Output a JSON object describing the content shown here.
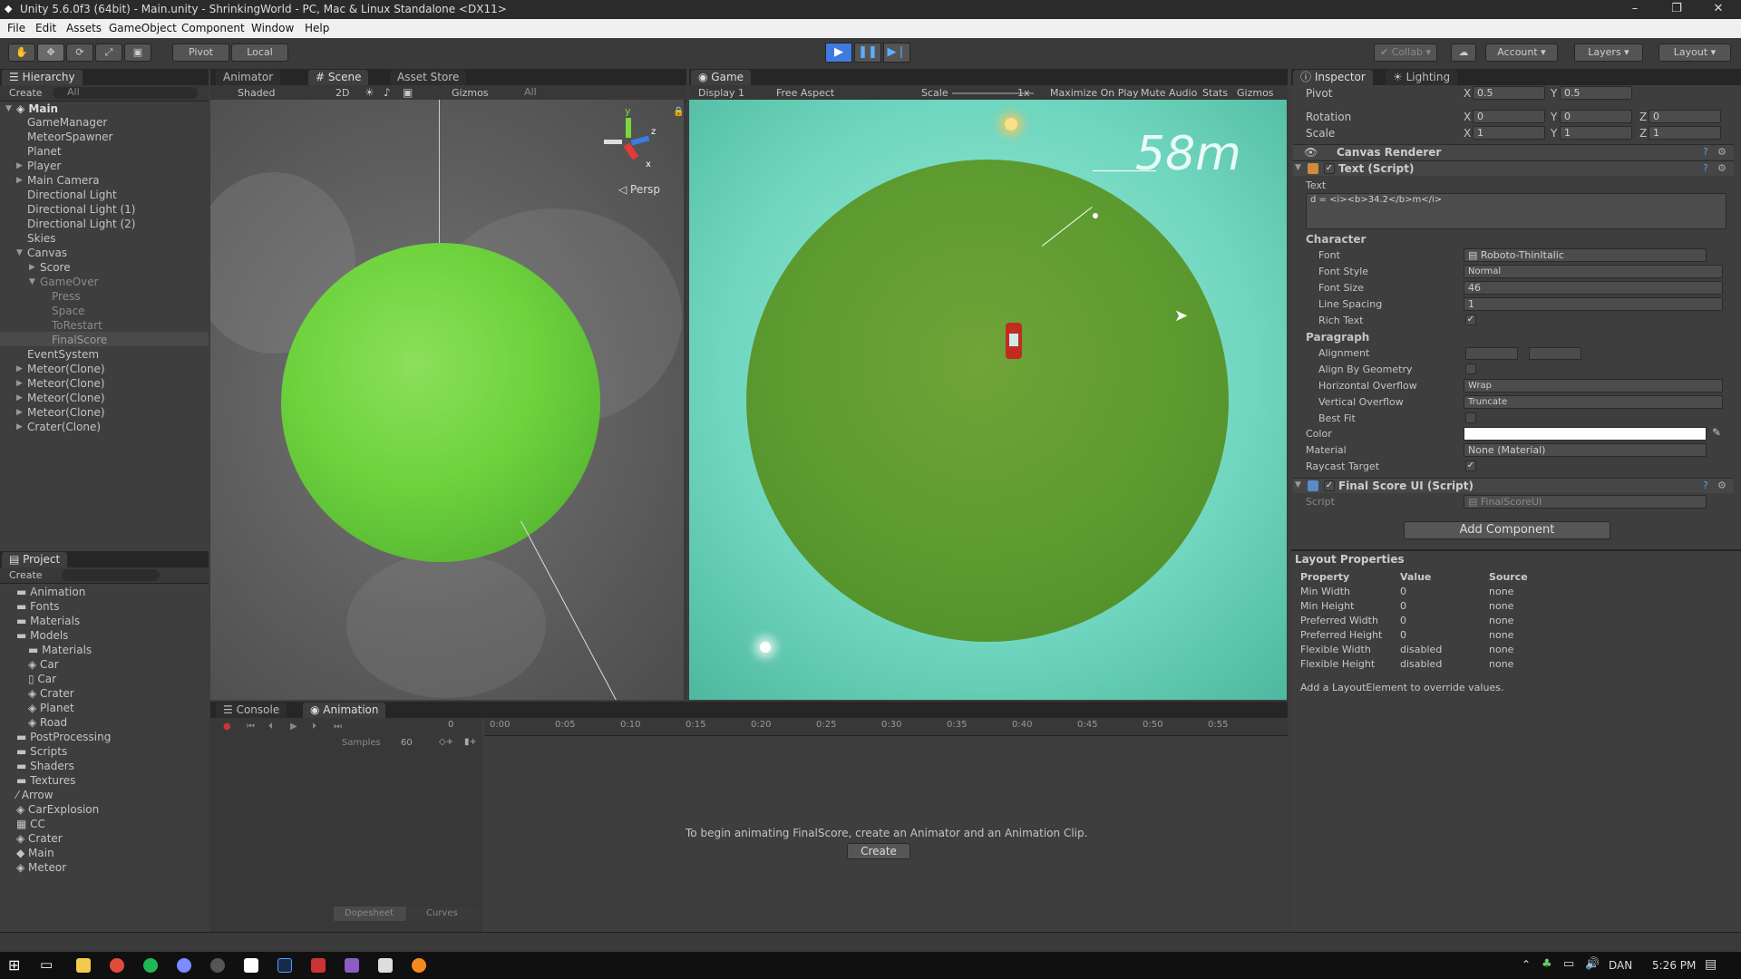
{
  "window": {
    "title": "Unity 5.6.0f3 (64bit) - Main.unity - ShrinkingWorld - PC, Mac & Linux Standalone <DX11>",
    "minimize": "–",
    "maximize": "❐",
    "close": "✕"
  },
  "menu": [
    "File",
    "Edit",
    "Assets",
    "GameObject",
    "Component",
    "Window",
    "Help"
  ],
  "toolbar": {
    "pivot": "Pivot",
    "local": "Local",
    "collab": "Collab",
    "account": "Account",
    "layers": "Layers",
    "layout": "Layout"
  },
  "hierarchy": {
    "tab": "Hierarchy",
    "create": "Create",
    "search": "All",
    "scene": "Main",
    "items": [
      "GameManager",
      "MeteorSpawner",
      "Planet",
      "Player",
      "Main Camera",
      "Directional Light",
      "Directional Light (1)",
      "Directional Light (2)",
      "Skies",
      "Canvas",
      "Score",
      "GameOver",
      "Press",
      "Space",
      "ToRestart",
      "FinalScore",
      "EventSystem",
      "Meteor(Clone)",
      "Meteor(Clone)",
      "Meteor(Clone)",
      "Meteor(Clone)",
      "Crater(Clone)"
    ]
  },
  "project": {
    "tab": "Project",
    "create": "Create",
    "items": [
      "Animation",
      "Fonts",
      "Materials",
      "Models",
      "Materials",
      "Car",
      "Car",
      "Crater",
      "Planet",
      "Road",
      "PostProcessing",
      "Scripts",
      "Shaders",
      "Textures",
      "Arrow",
      "CarExplosion",
      "CC",
      "Crater",
      "Main",
      "Meteor"
    ]
  },
  "scene": {
    "tabs": [
      "Animator",
      "Scene",
      "Asset Store"
    ],
    "shading": "Shaded",
    "mode2d": "2D",
    "gizmos": "Gizmos",
    "search": "All",
    "persp": "Persp",
    "axis_y": "y",
    "axis_z": "z",
    "axis_x": "x"
  },
  "game": {
    "tab": "Game",
    "display": "Display 1",
    "aspect": "Free Aspect",
    "scale_label": "Scale",
    "scale_value": "1x",
    "maximize": "Maximize On Play",
    "mute": "Mute Audio",
    "stats": "Stats",
    "gizmos": "Gizmos",
    "distance": "58m"
  },
  "animation": {
    "tabs": [
      "Console",
      "Animation"
    ],
    "samples_label": "Samples",
    "samples_value": "60",
    "frame": "0",
    "ticks": [
      "0:00",
      "0:05",
      "0:10",
      "0:15",
      "0:20",
      "0:25",
      "0:30",
      "0:35",
      "0:40",
      "0:45",
      "0:50",
      "0:55"
    ],
    "message": "To begin animating FinalScore, create an Animator and an Animation Clip.",
    "create": "Create",
    "dopesheet": "Dopesheet",
    "curves": "Curves"
  },
  "inspector": {
    "tabs": [
      "Inspector",
      "Lighting"
    ],
    "pivot": {
      "label": "Pivot",
      "x": "0.5",
      "y": "0.5"
    },
    "rotation": {
      "label": "Rotation",
      "x": "0",
      "y": "0",
      "z": "0"
    },
    "scale": {
      "label": "Scale",
      "x": "1",
      "y": "1",
      "z": "1"
    },
    "axis_x": "X",
    "axis_y": "Y",
    "axis_z": "Z",
    "canvas_renderer": "Canvas Renderer",
    "text_script": "Text (Script)",
    "text_label": "Text",
    "text_value": "d = <i><b>34.2</b>m</i>",
    "character": "Character",
    "font_label": "Font",
    "font_value": "Roboto-ThinItalic",
    "font_style_label": "Font Style",
    "font_style_value": "Normal",
    "font_size_label": "Font Size",
    "font_size_value": "46",
    "line_spacing_label": "Line Spacing",
    "line_spacing_value": "1",
    "rich_text_label": "Rich Text",
    "paragraph": "Paragraph",
    "alignment_label": "Alignment",
    "align_geometry_label": "Align By Geometry",
    "h_overflow_label": "Horizontal Overflow",
    "h_overflow_value": "Wrap",
    "v_overflow_label": "Vertical Overflow",
    "v_overflow_value": "Truncate",
    "best_fit_label": "Best Fit",
    "color_label": "Color",
    "material_label": "Material",
    "material_value": "None (Material)",
    "raycast_label": "Raycast Target",
    "final_score_script": "Final Score UI (Script)",
    "script_label": "Script",
    "script_value": "FinalScoreUI",
    "add_component": "Add Component"
  },
  "layout_props": {
    "title": "Layout Properties",
    "headers": [
      "Property",
      "Value",
      "Source"
    ],
    "rows": [
      [
        "Min Width",
        "0",
        "none"
      ],
      [
        "Min Height",
        "0",
        "none"
      ],
      [
        "Preferred Width",
        "0",
        "none"
      ],
      [
        "Preferred Height",
        "0",
        "none"
      ],
      [
        "Flexible Width",
        "disabled",
        "none"
      ],
      [
        "Flexible Height",
        "disabled",
        "none"
      ]
    ],
    "hint": "Add a LayoutElement to override values."
  },
  "taskbar": {
    "lang": "DAN",
    "time": "5:26 PM"
  },
  "colors": {
    "play_active": "#3d7be0",
    "planet_green": "#6ed23e",
    "game_sky": "#70d6bf"
  }
}
